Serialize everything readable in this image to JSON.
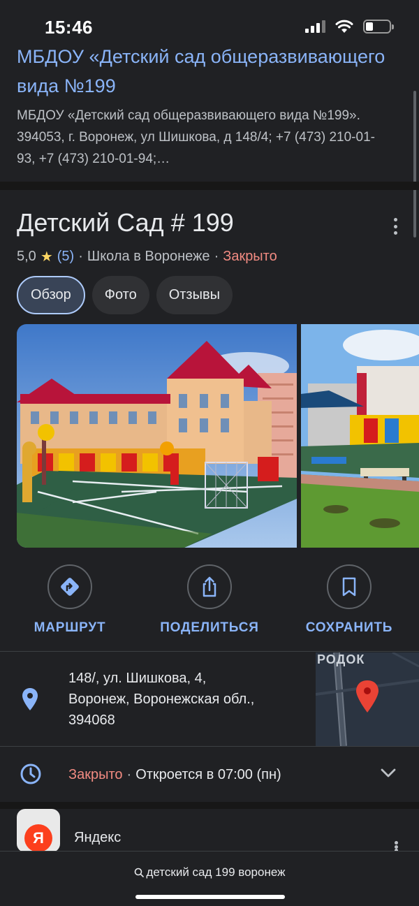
{
  "status_bar": {
    "time": "15:46"
  },
  "result": {
    "title": "МБДОУ «Детский сад общеразвивающего вида №199",
    "snippet": "МБДОУ «Детский сад общеразвивающего вида №199». 394053, г. Воронеж, ул Шишкова, д 148/4; +7 (473) 210-01-93, +7 (473) 210-01-94;…"
  },
  "place": {
    "name": "Детский Сад # 199",
    "rating": "5,0",
    "reviews": "(5)",
    "separator": "·",
    "category": "Школа в Воронеже",
    "status": "Закрыто"
  },
  "tabs": [
    {
      "label": "Обзор",
      "active": true
    },
    {
      "label": "Фото",
      "active": false
    },
    {
      "label": "Отзывы",
      "active": false
    }
  ],
  "actions": {
    "route": "МАРШРУТ",
    "share": "ПОДЕЛИТЬСЯ",
    "save": "СОХРАНИТЬ"
  },
  "address": {
    "line1": "148/, ул. Шишкова, 4,",
    "line2": "Воронеж, Воронежская обл.,",
    "line3": "394068",
    "map_label": "РОДОК"
  },
  "hours": {
    "status": "Закрыто",
    "separator": "·",
    "opens": "Откроется в 07:00 (пн)"
  },
  "source": {
    "name": "Яндекс",
    "logo_letter": "Я"
  },
  "search": {
    "query": "детский сад 199 воронеж"
  },
  "colors": {
    "background": "#202124",
    "link": "#8ab4f8",
    "closed": "#f28b82",
    "star": "#fdd663"
  }
}
